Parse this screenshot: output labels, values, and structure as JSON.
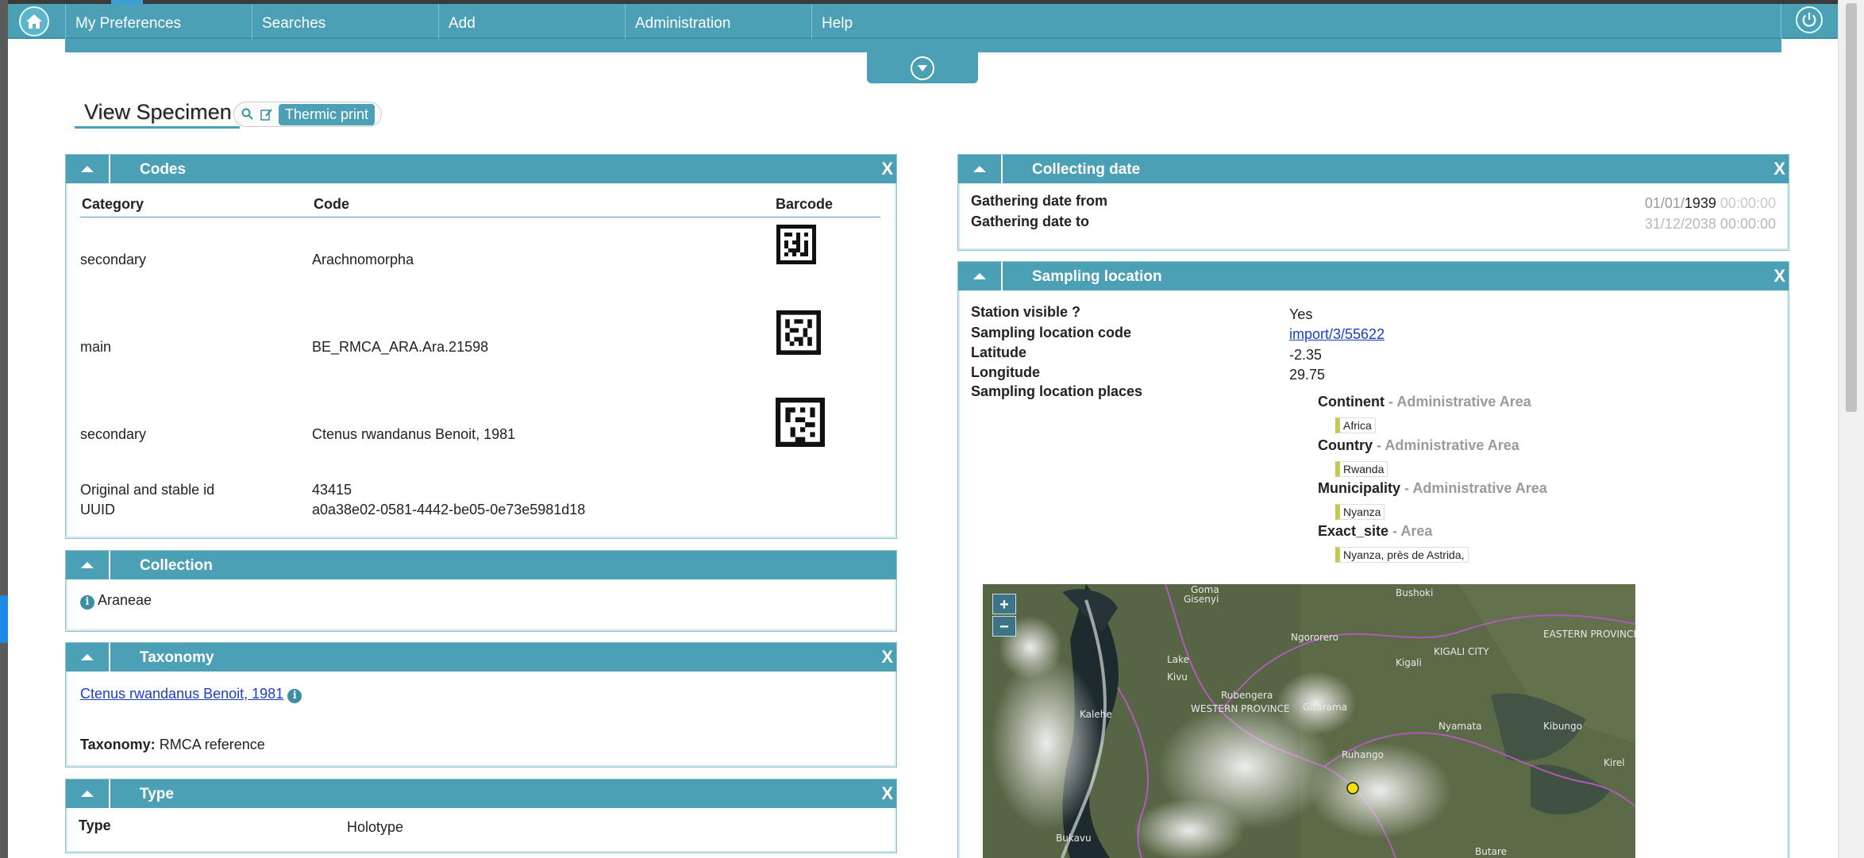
{
  "nav": {
    "menu": [
      "My Preferences",
      "Searches",
      "Add",
      "Administration",
      "Help"
    ]
  },
  "page": {
    "title": "View Specimen",
    "thermic_print": "Thermic print"
  },
  "codes": {
    "header": "Codes",
    "col_category": "Category",
    "col_code": "Code",
    "col_barcode": "Barcode",
    "rows": [
      {
        "category": "secondary",
        "code": "Arachnomorpha"
      },
      {
        "category": "main",
        "code": "BE_RMCA_ARA.Ara.21598"
      },
      {
        "category": "secondary",
        "code": "Ctenus rwandanus Benoit, 1981"
      }
    ],
    "original_label": "Original and stable id",
    "original_value": "43415",
    "uuid_label": "UUID",
    "uuid_value": "a0a38e02-0581-4442-be05-0e73e5981d18"
  },
  "collection": {
    "header": "Collection",
    "value": "Araneae"
  },
  "taxonomy": {
    "header": "Taxonomy",
    "name": "Ctenus rwandanus Benoit, 1981",
    "label": "Taxonomy:",
    "value": "RMCA reference"
  },
  "type": {
    "header": "Type",
    "label": "Type",
    "value": "Holotype"
  },
  "collecting_date": {
    "header": "Collecting date",
    "from_label": "Gathering date from",
    "from_dm": "01/01/",
    "from_year": "1939",
    "from_time": "00:00:00",
    "to_value": "31/12/2038 00:00:00",
    "to_label": "Gathering date to"
  },
  "sampling": {
    "header": "Sampling location",
    "station_label": "Station visible ?",
    "station_value": "Yes",
    "code_label": "Sampling location code",
    "code_value": "import/3/55622",
    "lat_label": "Latitude",
    "lat_value": "-2.35",
    "lon_label": "Longitude",
    "lon_value": "29.75",
    "places_label": "Sampling location places",
    "places": [
      {
        "name": "Continent",
        "kind": "- Administrative Area",
        "value": "Africa"
      },
      {
        "name": "Country",
        "kind": "- Administrative Area",
        "value": "Rwanda"
      },
      {
        "name": "Municipality",
        "kind": "- Administrative Area",
        "value": "Nyanza"
      },
      {
        "name": "Exact_site",
        "kind": "- Area",
        "value": "Nyanza, près de Astrida,"
      }
    ]
  },
  "map": {
    "zoom_in": "+",
    "zoom_out": "−",
    "labels": [
      "Goma",
      "Gisenyi",
      "Bushoki",
      "Ngororero",
      "Lake",
      "Kivu",
      "Kigali",
      "Rubengera",
      "Kalehe",
      "WESTERN PROVINCE",
      "Gitarama",
      "Nyamata",
      "Kibungo",
      "Ruhango",
      "Kirel",
      "Bukavu",
      "Butare",
      "EASTERN PROVINCE",
      "KIGALI CITY"
    ]
  },
  "colors": {
    "accent": "#4ba0b5",
    "link": "#1a3fc4",
    "tag_marker": "#c5c857"
  },
  "icons": [
    "home-icon",
    "power-icon",
    "chevron-down-icon",
    "chevron-up-icon",
    "close-icon",
    "search-icon",
    "edit-icon",
    "info-icon"
  ]
}
